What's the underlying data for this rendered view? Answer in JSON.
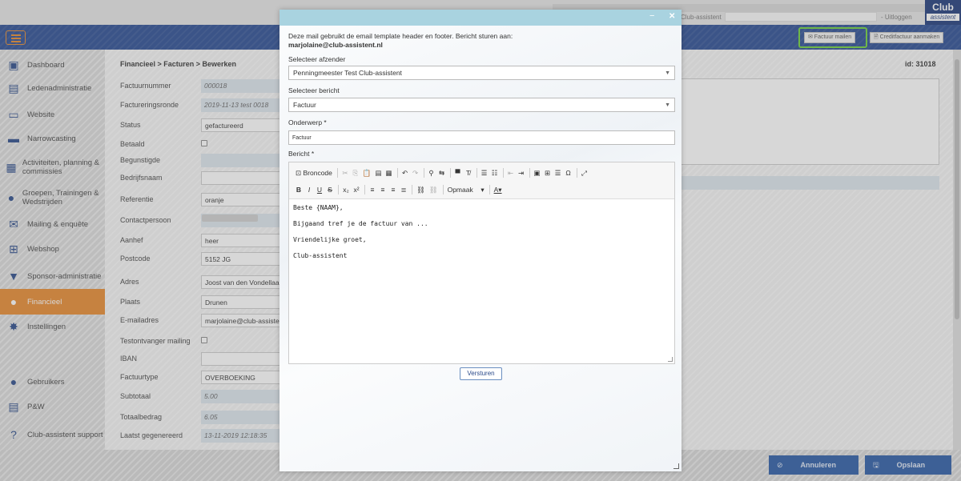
{
  "topbar": {
    "club_label": "Club-assistent",
    "logout": "- Uitloggen",
    "logo_top": "Club",
    "logo_bottom": "assistent"
  },
  "navbar": {
    "menu_icon": "hamburger-icon",
    "mail_invoice_button": "✉ Factuur mailen",
    "credit_invoice_button": "🗎 Creditfactuur aanmaken"
  },
  "sidebar": {
    "items": [
      {
        "label": "Dashboard",
        "icon": "dashboard-icon",
        "glyph": "▣"
      },
      {
        "label": "Ledenadministratie",
        "icon": "id-card-icon",
        "glyph": "▤"
      },
      {
        "label": "Website",
        "icon": "laptop-icon",
        "glyph": "▭"
      },
      {
        "label": "Narrowcasting",
        "icon": "monitor-icon",
        "glyph": "▬"
      },
      {
        "label": "Activiteiten, planning & commissies",
        "icon": "calendar-icon",
        "glyph": "▦"
      },
      {
        "label": "Groepen, Trainingen & Wedstrijden",
        "icon": "group-icon",
        "glyph": "●"
      },
      {
        "label": "Mailing & enquête",
        "icon": "envelope-icon",
        "glyph": "✉"
      },
      {
        "label": "Webshop",
        "icon": "basket-icon",
        "glyph": "⊞"
      },
      {
        "label": "Sponsor-administratie",
        "icon": "shirt-icon",
        "glyph": "▼"
      },
      {
        "label": "Financieel",
        "icon": "piggy-bank-icon",
        "glyph": "●"
      },
      {
        "label": "Instellingen",
        "icon": "gear-icon",
        "glyph": "✸"
      },
      {
        "label": "Gebruikers",
        "icon": "user-icon",
        "glyph": "●"
      },
      {
        "label": "P&W",
        "icon": "news-icon",
        "glyph": "▤"
      },
      {
        "label": "Club-assistent support",
        "icon": "question-icon",
        "glyph": "?"
      }
    ]
  },
  "main": {
    "breadcrumb": "Financieel   > Facturen > Bewerken",
    "record_id": "id: 31018",
    "fields": [
      {
        "label": "Factuurnummer",
        "value": "000018"
      },
      {
        "label": "Factureringsronde",
        "value": "2019-11-13 test 0018"
      },
      {
        "label": "Status",
        "value": "gefactureerd"
      },
      {
        "label": "Betaald",
        "value": ""
      },
      {
        "label": "Begunstigde",
        "value": ""
      },
      {
        "label": "Bedrijfsnaam",
        "value": ""
      },
      {
        "label": "Referentie",
        "value": "oranje"
      },
      {
        "label": "Contactpersoon",
        "value": ""
      },
      {
        "label": "Aanhef",
        "value": "heer"
      },
      {
        "label": "Postcode",
        "value": "5152 JG"
      },
      {
        "label": "Adres",
        "value": "Joost van den Vondellaan"
      },
      {
        "label": "Plaats",
        "value": "Drunen"
      },
      {
        "label": "E-mailadres",
        "value": "marjolaine@club-assistent.nl"
      },
      {
        "label": "Testontvanger mailing",
        "value": ""
      },
      {
        "label": "IBAN",
        "value": ""
      },
      {
        "label": "Factuurtype",
        "value": "OVERBOEKING"
      },
      {
        "label": "Subtotaal",
        "value": "5.00"
      },
      {
        "label": "Totaalbedrag",
        "value": "6.05"
      },
      {
        "label": "Laatst gegenereerd",
        "value": "13-11-2019 12:18:35"
      }
    ]
  },
  "footer": {
    "cancel_button": "Annuleren",
    "save_button": "Opslaan"
  },
  "modal": {
    "minimize": "−",
    "close": "✕",
    "intro_text": "Deze mail gebruikt de email template header en footer. Bericht sturen aan:",
    "recipient": "marjolaine@club-assistent.nl",
    "sender_label": "Selecteer afzender",
    "sender_value": "Penningmeester Test Club-assistent",
    "message_label": "Selecteer bericht",
    "message_value": "Factuur",
    "subject_label": "Onderwerp *",
    "subject_value": "Factuur",
    "body_label": "Bericht *",
    "toolbar": {
      "source": "Broncode",
      "format": "Opmaak"
    },
    "body_lines": [
      "Beste {NAAM},",
      "Bijgaand tref je de factuur van ...",
      "Vriendelijke groet,",
      "Club-assistent"
    ],
    "send_button": "Versturen"
  }
}
